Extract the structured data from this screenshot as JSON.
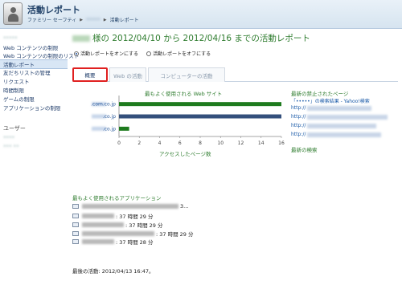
{
  "header": {
    "title": "活動レポート",
    "breadcrumb": [
      "ファミリー セーフティ",
      "•••••",
      "活動レポート"
    ]
  },
  "sidebar": {
    "top_user": "•••••",
    "items": [
      "Web コンテンツの制限",
      "Web コンテンツの制限のリスト",
      "活動レポート",
      "友だちリストの管理",
      "リクエスト",
      "時間制限",
      "ゲームの制限",
      "アプリケーションの制限"
    ],
    "selected_index": 2,
    "users_heading": "ユーザー",
    "users": [
      "••••",
      "••• ••"
    ]
  },
  "main": {
    "title_text": "様の 2012/04/10 から 2012/04/16 までの活動レポート",
    "radio_on": "活動レポートをオンにする",
    "radio_off": "活動レポートをオフにする",
    "tabs": [
      "概要",
      "Web の活動",
      "コンピューターの活動"
    ],
    "active_tab": 0
  },
  "chart_data": {
    "type": "bar",
    "orientation": "horizontal",
    "title": "最もよく使用される Web サイト",
    "xlabel": "アクセスしたページ数",
    "ylabel": "",
    "categories": [
      ".com.co.jp",
      ".co.jp",
      ".co.jp"
    ],
    "values": [
      16,
      16,
      1
    ],
    "bar_colors": [
      "#1e7b1e",
      "#34507c",
      "#1e7b1e"
    ],
    "xlim": [
      0,
      16
    ],
    "xticks": [
      0,
      2,
      4,
      6,
      8,
      10,
      12,
      14,
      16
    ],
    "grid": false,
    "legend": "none"
  },
  "right": {
    "blocked_heading": "最新の禁止されたページ",
    "blocked_links": [
      "「•••••」の検索結果 - Yahoo!検索",
      "http://",
      "http://",
      "http://",
      "http://"
    ],
    "search_heading": "最新の検索"
  },
  "apps": {
    "heading": "最もよく使用されるアプリケーション",
    "rows": [
      "3...",
      ": 37 時間 29 分",
      ": 37 時間 29 分",
      ": 37 時間 29 分",
      ": 37 時間 28 分"
    ]
  },
  "footer": {
    "last_activity": "最後の活動: 2012/04/13 16:47。"
  }
}
